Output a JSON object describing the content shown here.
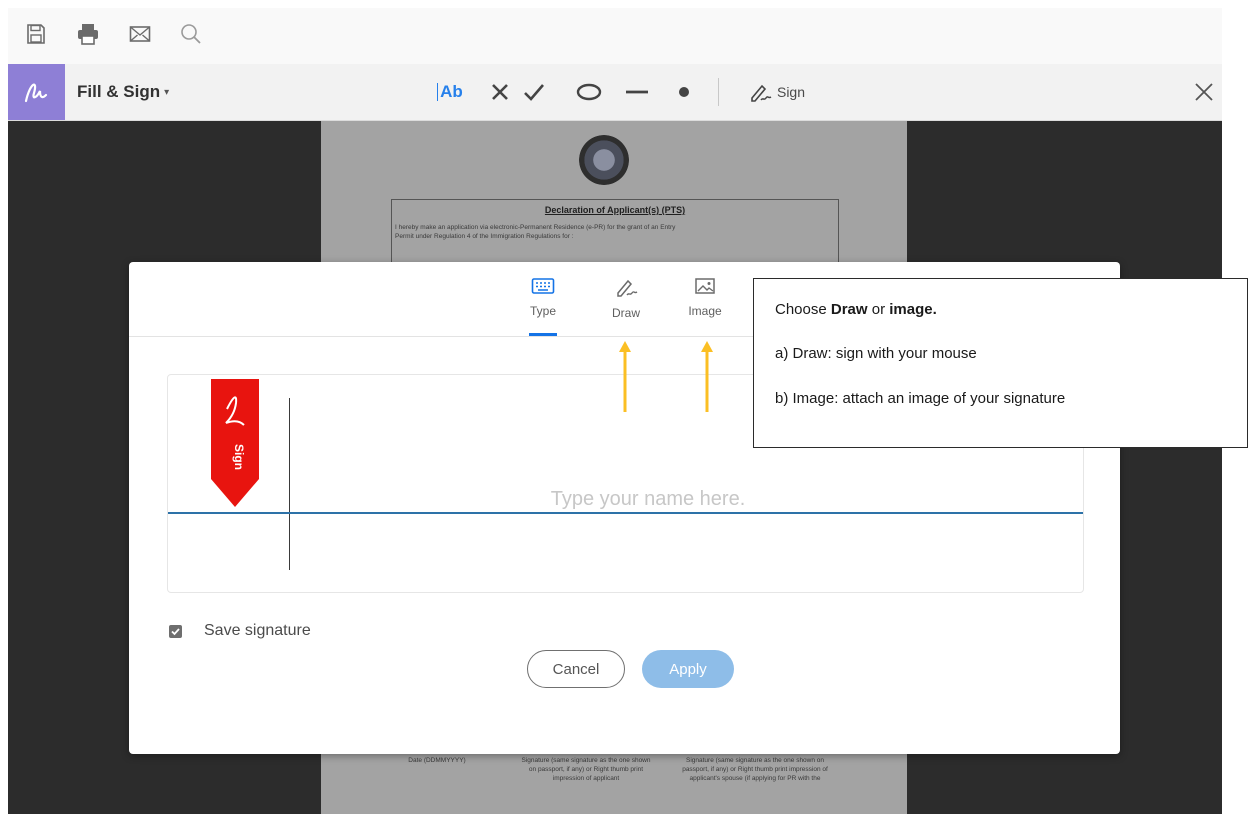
{
  "toolbar": {
    "icons": [
      "save-icon",
      "print-icon",
      "mail-icon",
      "search-icon"
    ]
  },
  "fill_sign_bar": {
    "title": "Fill & Sign",
    "caret": "▾",
    "tools": [
      "text-tool-icon",
      "cross-tool-icon",
      "check-tool-icon",
      "ellipse-tool-icon",
      "line-tool-icon",
      "dot-tool-icon"
    ],
    "text_tool_label": "Ab",
    "sign_label": "Sign"
  },
  "document": {
    "heading": "Declaration of Applicant(s) (PTS)",
    "line1": "I hereby make an application via electronic-Permanent Residence (e-PR) for the grant of an Entry",
    "line2": "Permit under Regulation 4 of the Immigration Regulations for :",
    "bottom_date": "Date (DDMMYYYY)",
    "bottom_sig1": "Signature (same signature as the one shown on passport, if any) or Right thumb print impression of applicant",
    "bottom_sig2": "Signature (same signature as the one shown on passport, if any) or Right thumb print impression of applicant's spouse (if applying for PR with the"
  },
  "dialog": {
    "tabs": [
      {
        "label": "Type",
        "icon": "keyboard-icon",
        "active": true
      },
      {
        "label": "Draw",
        "icon": "pen-signature-icon",
        "active": false
      },
      {
        "label": "Image",
        "icon": "image-icon",
        "active": false
      }
    ],
    "ribbon_label": "Sign",
    "name_placeholder": "Type your name here.",
    "save_signature_label": "Save signature",
    "save_signature_checked": true,
    "cancel_label": "Cancel",
    "apply_label": "Apply"
  },
  "callout": {
    "line1_prefix": "Choose ",
    "line1_draw": "Draw",
    "line1_or": " or ",
    "line1_image": "image.",
    "line2": "a) Draw: sign with your mouse",
    "line3": "b) Image: attach an image of your signature"
  },
  "colors": {
    "accent": "#1473e6",
    "fill_sign_logo": "#8e7fd6",
    "ribbon": "#e8140f",
    "arrow": "#fbbf24",
    "apply_disabled": "#8ebde8"
  }
}
